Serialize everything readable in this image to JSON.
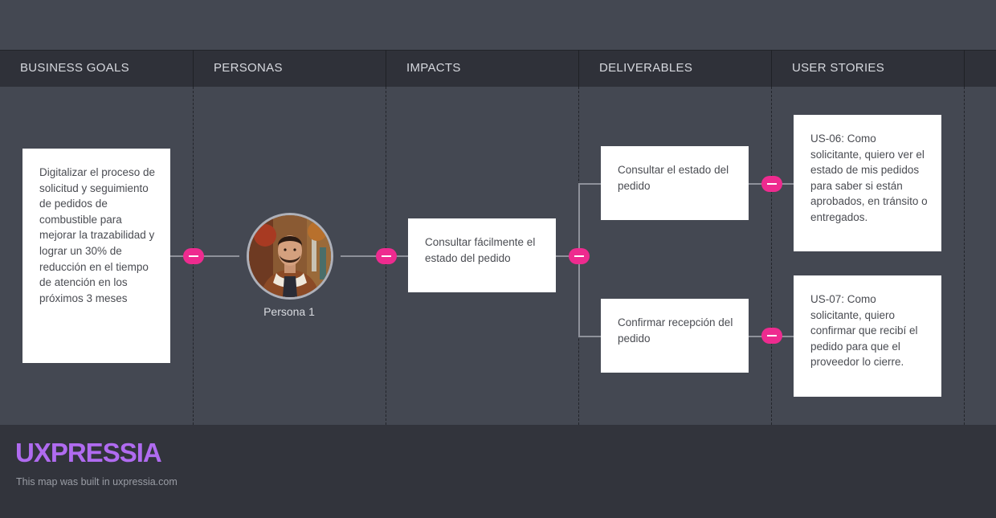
{
  "columns": {
    "business_goals": "BUSINESS GOALS",
    "personas": "PERSONAS",
    "impacts": "IMPACTS",
    "deliverables": "DELIVERABLES",
    "user_stories": "USER STORIES"
  },
  "business_goal": {
    "text": "Digitalizar el proceso de solicitud y seguimiento de pedidos de combustible para mejorar la trazabilidad y lograr un 30% de reducción en el tiempo de atención en los próximos 3 meses"
  },
  "persona": {
    "name": "Persona 1"
  },
  "impact": {
    "text": "Consultar fácilmente el estado del pedido"
  },
  "deliverables": [
    {
      "text": "Consultar el estado del pedido"
    },
    {
      "text": "Confirmar recepción del pedido"
    }
  ],
  "user_stories": [
    {
      "text": "US-06: Como solicitante, quiero ver el estado de mis pedidos para saber si están aprobados, en tránsito o entregados."
    },
    {
      "text": "US-07: Como solicitante, quiero confirmar que recibí el pedido para que el proveedor lo cierre."
    }
  ],
  "footer": {
    "brand": "UXPRESSIA",
    "credit": "This map was built in uxpressia.com"
  },
  "colors": {
    "connector": "#ee2b8f",
    "brand": "#b06bf0",
    "canvas": "#444852",
    "header": "#2f3139"
  }
}
